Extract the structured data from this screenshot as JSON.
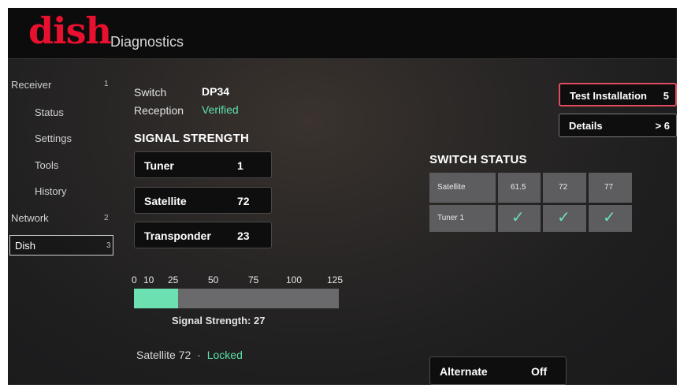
{
  "header": {
    "logo": "dish",
    "title": "Diagnostics"
  },
  "sidebar": {
    "items": [
      {
        "label": "Receiver",
        "num": "1"
      },
      {
        "label": "Status"
      },
      {
        "label": "Settings"
      },
      {
        "label": "Tools"
      },
      {
        "label": "History"
      },
      {
        "label": "Network",
        "num": "2"
      },
      {
        "label": "Dish",
        "num": "3"
      }
    ]
  },
  "info": {
    "switch_label": "Switch",
    "switch_value": "DP34",
    "reception_label": "Reception",
    "reception_value": "Verified"
  },
  "signal": {
    "heading": "SIGNAL STRENGTH",
    "tuner_label": "Tuner",
    "tuner_value": "1",
    "satellite_label": "Satellite",
    "satellite_value": "72",
    "transponder_label": "Transponder",
    "transponder_value": "23",
    "scale": [
      "0",
      "10",
      "25",
      "50",
      "75",
      "100",
      "125"
    ],
    "strength_value": 27,
    "strength_max": 125,
    "strength_text": "Signal Strength: 27"
  },
  "status_line": {
    "satellite": "Satellite 72",
    "separator": "·",
    "state": "Locked"
  },
  "buttons": {
    "test_label": "Test Installation",
    "test_key": "5",
    "details_label": "Details",
    "details_key": "> 6"
  },
  "switch_status": {
    "heading": "SWITCH STATUS",
    "row1_label": "Satellite",
    "columns": [
      "61.5",
      "72",
      "77"
    ],
    "row2_label": "Tuner 1",
    "row2": [
      "check",
      "check",
      "check"
    ],
    "check_glyph": "✓"
  },
  "alternate": {
    "label": "Alternate",
    "value": "Off"
  },
  "colors": {
    "accent_green": "#6ce0b0",
    "logo_red": "#e8102f",
    "focus_border": "#e24a5e"
  }
}
